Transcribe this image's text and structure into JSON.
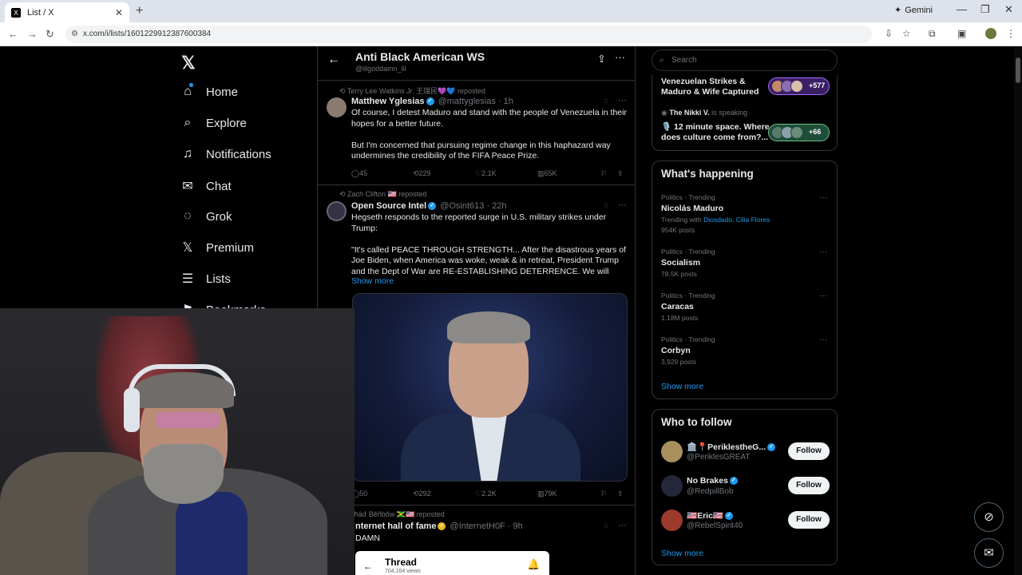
{
  "browser": {
    "tab_title": "List / X",
    "tab_favicon": "X",
    "gemini_label": "Gemini",
    "url": "x.com/i/lists/1601229912387600384"
  },
  "nav": {
    "logo": "𝕏",
    "items": [
      {
        "label": "Home",
        "icon": "⌂"
      },
      {
        "label": "Explore",
        "icon": "⌕"
      },
      {
        "label": "Notifications",
        "icon": "♫"
      },
      {
        "label": "Chat",
        "icon": "✉"
      },
      {
        "label": "Grok",
        "icon": "◌"
      },
      {
        "label": "Premium",
        "icon": "𝕏"
      },
      {
        "label": "Lists",
        "icon": "☰"
      },
      {
        "label": "Bookmarks",
        "icon": "⚑"
      }
    ]
  },
  "timeline": {
    "title": "Anti Black American WS",
    "handle": "@lilgoddamn_lil"
  },
  "posts": [
    {
      "repost_by": "Terry Lee Watkins Jr. 王瑞民💜💙 reposted",
      "name": "Matthew Yglesias",
      "meta": "@mattyglesias · 1h",
      "text": "Of course, I detest Maduro and stand with the people of Venezuela in their hopes for a better future.\n\nBut I'm concerned that pursuing regime change in this haphazard way undermines the credibility of the FIFA Peace Prize.",
      "replies": "45",
      "reposts": "229",
      "likes": "2.1K",
      "views": "65K"
    },
    {
      "repost_by": "Zach Clifton 🇺🇸 reposted",
      "name": "Open Source Intel",
      "meta": "@Osint613 · 22h",
      "text": "Hegseth responds to the reported surge in U.S. military strikes under Trump:\n\n\"It's called PEACE THROUGH STRENGTH... After the disastrous years of Joe Biden, when America was woke, weak & in retreat, President Trump and the Dept of War are RE-ESTABLISHING DETERRENCE. We will",
      "show_more": "Show more",
      "replies": "50",
      "reposts": "292",
      "likes": "2.2K",
      "views": "79K"
    },
    {
      "repost_by": "ɛçħäď Bĕñbŏw 🇯🇲🇺🇸 reposted",
      "name": "nternet hall of fame",
      "meta": "@InternetH0F · 9h",
      "text": "DAMN",
      "thread_title": "Thread",
      "thread_views": "704,164 views"
    }
  ],
  "sidebar": {
    "search_placeholder": "Search",
    "spaces": [
      {
        "title": "Venezuelan Strikes & Maduro & Wife Captured",
        "count": "+577"
      },
      {
        "host": "The Nikki V.",
        "host_suffix": " is speaking",
        "title": "🎙️ 12 minute space. Where does culture come from?...",
        "count": "+66"
      }
    ],
    "whats_happening": {
      "title": "What's happening",
      "trends": [
        {
          "category": "Politics · Trending",
          "name": "Nicolás Maduro",
          "with_prefix": "Trending with ",
          "with": "Diosdado, Cilia Flores",
          "posts": "954K posts"
        },
        {
          "category": "Politics · Trending",
          "name": "Socialism",
          "posts": "78.5K posts"
        },
        {
          "category": "Politics · Trending",
          "name": "Caracas",
          "posts": "1.18M posts"
        },
        {
          "category": "Politics · Trending",
          "name": "Corbyn",
          "posts": "3,929 posts"
        }
      ],
      "show_more": "Show more"
    },
    "who_to_follow": {
      "title": "Who to follow",
      "accounts": [
        {
          "name": "🏛️📍PeriklestheG...",
          "handle": "@PeriklesGREAT",
          "button": "Follow"
        },
        {
          "name": "No Brakes",
          "handle": "@RedpillBob",
          "button": "Follow"
        },
        {
          "name": "🇺🇸Eric🇺🇸",
          "handle": "@RebelSpirit40",
          "button": "Follow"
        }
      ],
      "show_more": "Show more"
    }
  },
  "colors": {
    "accent": "#1d9bf0",
    "background": "#000000",
    "border": "#2f3336",
    "muted": "#71767b"
  }
}
